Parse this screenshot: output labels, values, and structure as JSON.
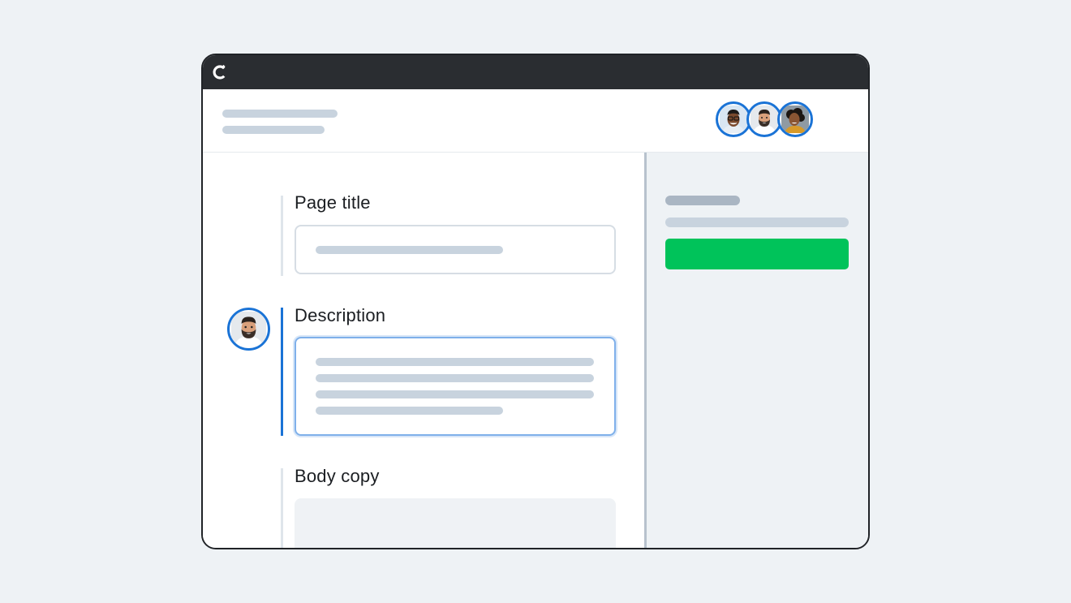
{
  "app": {
    "logo_icon": "c-logo-icon"
  },
  "collaborators": [
    {
      "name_icon": "person-glasses-avatar"
    },
    {
      "name_icon": "person-beard-avatar"
    },
    {
      "name_icon": "person-curly-hair-avatar"
    }
  ],
  "form": {
    "fields": [
      {
        "label": "Page title"
      },
      {
        "label": "Description"
      },
      {
        "label": "Body copy"
      }
    ]
  },
  "colors": {
    "accent": "#1a73d6",
    "primary_action": "#00c35a",
    "titlebar": "#2a2d31",
    "placeholder": "#c8d3de"
  }
}
